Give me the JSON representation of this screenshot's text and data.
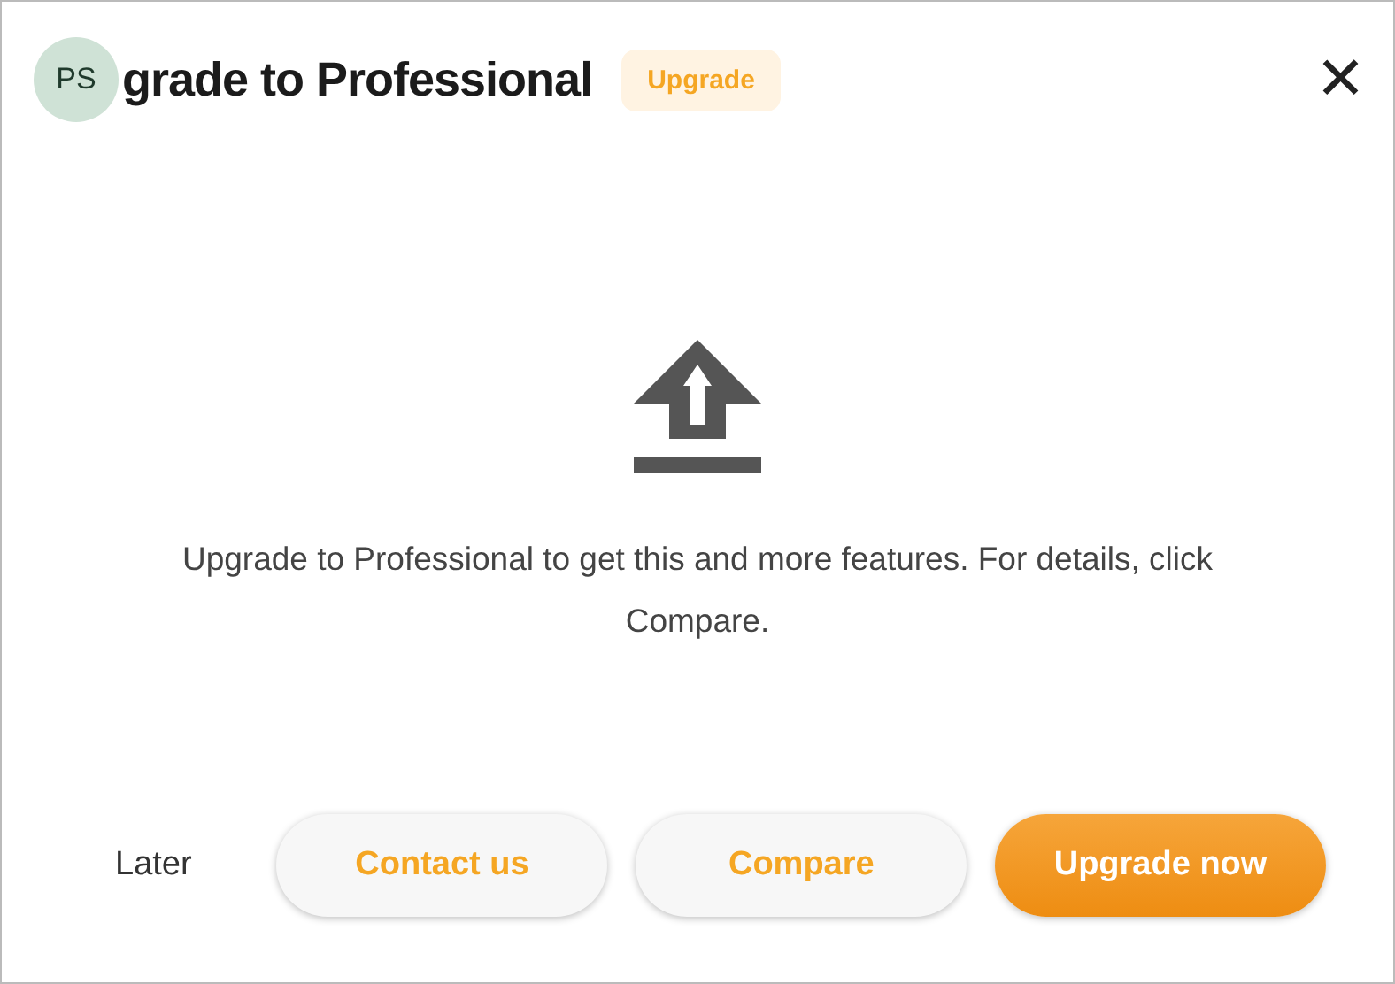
{
  "avatar": {
    "initials": "PS"
  },
  "title": "grade to Professional",
  "badge": "Upgrade",
  "close": "✕",
  "message": "Upgrade to Professional to get this and more features. For details, click Compare.",
  "buttons": [
    {
      "label": "Later",
      "kind": "text"
    },
    {
      "label": "Contact us",
      "kind": "secondary"
    },
    {
      "label": "Compare",
      "kind": "secondary"
    },
    {
      "label": "Upgrade now",
      "kind": "primary"
    }
  ]
}
